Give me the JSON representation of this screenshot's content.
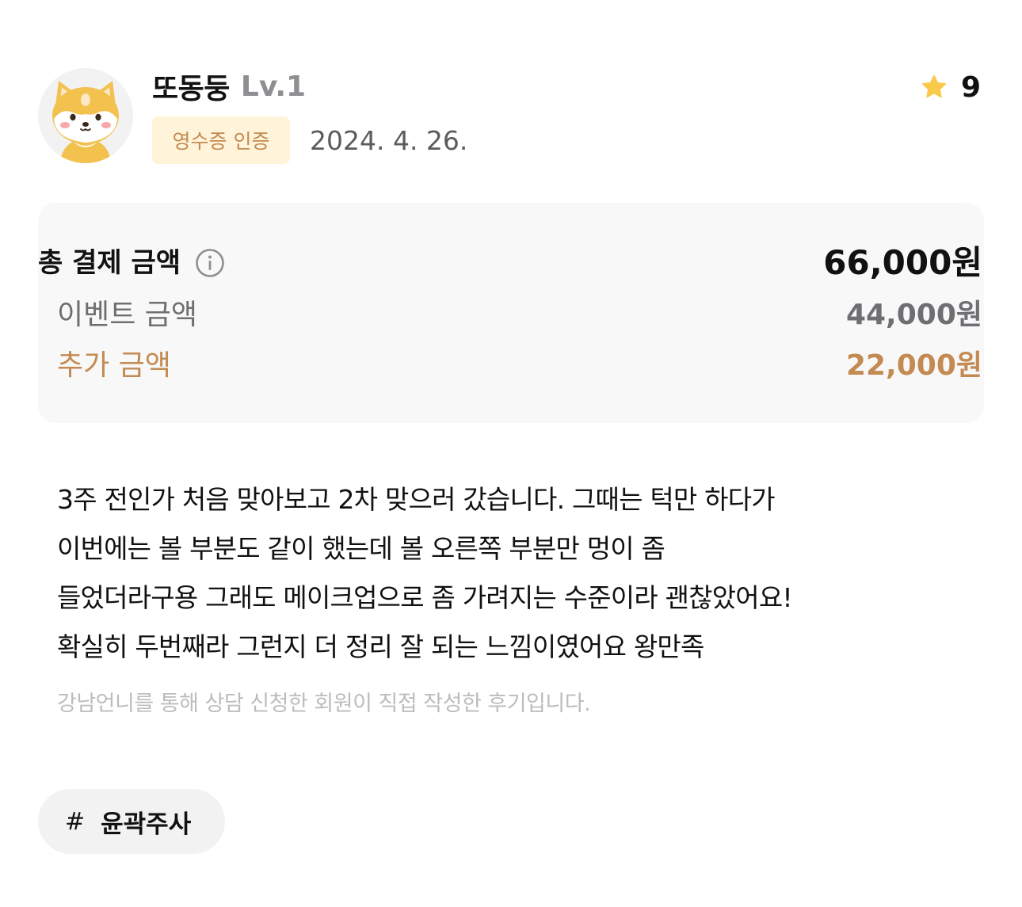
{
  "review": {
    "user": {
      "name": "또동둥",
      "level": "Lv.1",
      "avatar_icon": "shiba-dog-avatar-icon"
    },
    "rating": {
      "value": "9",
      "icon": "star-icon",
      "icon_color": "#f9c94a"
    },
    "badge": {
      "label": "영수증 인증",
      "color": "#c38a52",
      "background": "#fff4da"
    },
    "date": "2024. 4. 26.",
    "price": {
      "total_label": "총 결제 금액",
      "total_amount": "66,000원",
      "info_icon": "info-icon",
      "event_label": "이벤트 금액",
      "event_amount": "44,000원",
      "extra_label": "추가 금액",
      "extra_amount": "22,000원",
      "extra_color": "#c38a52"
    },
    "body_lines": [
      "3주 전인가 처음 맞아보고 2차 맞으러 갔습니다. 그때는 턱만 하다가",
      "이번에는 볼 부분도 같이 했는데 볼 오른쪽 부분만 멍이 좀",
      "들었더라구용 그래도 메이크업으로 좀 가려지는 수준이라 괜찮았어요!",
      "확실히 두번째라 그런지 더 정리 잘 되는 느낌이였어요 왕만족"
    ],
    "disclaimer": "강남언니를 통해 상담 신청한 회원이 직접 작성한 후기입니다.",
    "tag": {
      "hash": "#",
      "label": "윤곽주사"
    }
  }
}
